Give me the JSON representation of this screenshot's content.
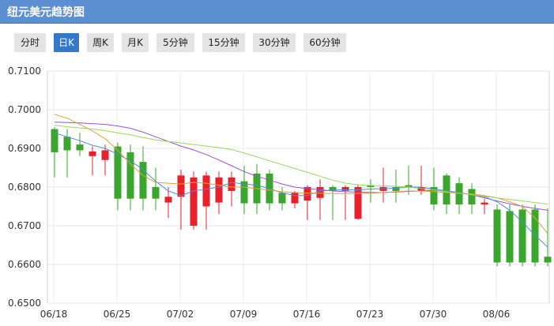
{
  "header": {
    "title": "纽元美元趋势图"
  },
  "tabs": [
    {
      "id": "fenshi",
      "label": "分时",
      "active": false
    },
    {
      "id": "rik",
      "label": "日K",
      "active": true
    },
    {
      "id": "zhouk",
      "label": "周K",
      "active": false
    },
    {
      "id": "yuek",
      "label": "月K",
      "active": false
    },
    {
      "id": "m5",
      "label": "5分钟",
      "active": false
    },
    {
      "id": "m15",
      "label": "15分钟",
      "active": false
    },
    {
      "id": "m30",
      "label": "30分钟",
      "active": false
    },
    {
      "id": "m60",
      "label": "60分钟",
      "active": false
    }
  ],
  "colors": {
    "up": "#e8202a",
    "down": "#3aa62c",
    "ma_purple": "#a050d0",
    "ma_blue": "#4a8fd8",
    "ma_orange": "#e0a040",
    "ma_green": "#98d85a"
  },
  "chart_data": {
    "type": "candlestick",
    "ylim": [
      0.65,
      0.71
    ],
    "yticks": [
      "0.7100",
      "0.7000",
      "0.6900",
      "0.6800",
      "0.6700",
      "0.6600",
      "0.6500"
    ],
    "xticks": [
      "06/18",
      "06/25",
      "07/02",
      "07/09",
      "07/16",
      "07/23",
      "07/30",
      "08/06"
    ],
    "candles": [
      {
        "o": 0.689,
        "c": 0.695,
        "h": 0.6955,
        "l": 0.6825
      },
      {
        "o": 0.6895,
        "c": 0.693,
        "h": 0.695,
        "l": 0.6825
      },
      {
        "o": 0.6895,
        "c": 0.691,
        "h": 0.694,
        "l": 0.688
      },
      {
        "o": 0.688,
        "c": 0.6892,
        "h": 0.6905,
        "l": 0.683
      },
      {
        "o": 0.687,
        "c": 0.6895,
        "h": 0.691,
        "l": 0.683
      },
      {
        "o": 0.677,
        "c": 0.6905,
        "h": 0.6915,
        "l": 0.674
      },
      {
        "o": 0.677,
        "c": 0.689,
        "h": 0.691,
        "l": 0.674
      },
      {
        "o": 0.677,
        "c": 0.6865,
        "h": 0.6905,
        "l": 0.674
      },
      {
        "o": 0.677,
        "c": 0.68,
        "h": 0.685,
        "l": 0.674
      },
      {
        "o": 0.676,
        "c": 0.6775,
        "h": 0.68,
        "l": 0.672
      },
      {
        "o": 0.6775,
        "c": 0.683,
        "h": 0.6845,
        "l": 0.669
      },
      {
        "o": 0.67,
        "c": 0.6825,
        "h": 0.684,
        "l": 0.669
      },
      {
        "o": 0.675,
        "c": 0.683,
        "h": 0.684,
        "l": 0.669
      },
      {
        "o": 0.676,
        "c": 0.6825,
        "h": 0.684,
        "l": 0.673
      },
      {
        "o": 0.679,
        "c": 0.6825,
        "h": 0.684,
        "l": 0.675
      },
      {
        "o": 0.6758,
        "c": 0.6815,
        "h": 0.6855,
        "l": 0.673
      },
      {
        "o": 0.6758,
        "c": 0.6835,
        "h": 0.686,
        "l": 0.673
      },
      {
        "o": 0.6758,
        "c": 0.6835,
        "h": 0.6845,
        "l": 0.674
      },
      {
        "o": 0.6758,
        "c": 0.6785,
        "h": 0.68,
        "l": 0.674
      },
      {
        "o": 0.6758,
        "c": 0.6785,
        "h": 0.679,
        "l": 0.6745
      },
      {
        "o": 0.6765,
        "c": 0.68,
        "h": 0.6805,
        "l": 0.6715
      },
      {
        "o": 0.6772,
        "c": 0.68,
        "h": 0.682,
        "l": 0.6715
      },
      {
        "o": 0.679,
        "c": 0.68,
        "h": 0.6805,
        "l": 0.6715
      },
      {
        "o": 0.679,
        "c": 0.68,
        "h": 0.6805,
        "l": 0.6715
      },
      {
        "o": 0.6718,
        "c": 0.68,
        "h": 0.6805,
        "l": 0.6715
      },
      {
        "o": 0.68,
        "c": 0.6805,
        "h": 0.682,
        "l": 0.676
      },
      {
        "o": 0.679,
        "c": 0.68,
        "h": 0.685,
        "l": 0.676
      },
      {
        "o": 0.679,
        "c": 0.68,
        "h": 0.6845,
        "l": 0.676
      },
      {
        "o": 0.68,
        "c": 0.6805,
        "h": 0.6855,
        "l": 0.678
      },
      {
        "o": 0.679,
        "c": 0.68,
        "h": 0.6855,
        "l": 0.678
      },
      {
        "o": 0.6755,
        "c": 0.68,
        "h": 0.685,
        "l": 0.674
      },
      {
        "o": 0.6755,
        "c": 0.683,
        "h": 0.6835,
        "l": 0.673
      },
      {
        "o": 0.6755,
        "c": 0.681,
        "h": 0.6825,
        "l": 0.673
      },
      {
        "o": 0.6755,
        "c": 0.6795,
        "h": 0.681,
        "l": 0.673
      },
      {
        "o": 0.6755,
        "c": 0.676,
        "h": 0.677,
        "l": 0.673
      },
      {
        "o": 0.6605,
        "c": 0.6742,
        "h": 0.6755,
        "l": 0.6595
      },
      {
        "o": 0.6605,
        "c": 0.6738,
        "h": 0.6755,
        "l": 0.6595
      },
      {
        "o": 0.6605,
        "c": 0.6742,
        "h": 0.6755,
        "l": 0.6595
      },
      {
        "o": 0.6605,
        "c": 0.6742,
        "h": 0.6755,
        "l": 0.6595
      },
      {
        "o": 0.6605,
        "c": 0.662,
        "h": 0.6745,
        "l": 0.6595
      }
    ],
    "moving_averages": [
      {
        "color": "#a050d0",
        "values": [
          0.6968,
          0.6967,
          0.6966,
          0.6964,
          0.6962,
          0.6958,
          0.6952,
          0.6942,
          0.693,
          0.6918,
          0.6906,
          0.6896,
          0.6884,
          0.687,
          0.6855,
          0.684,
          0.6828,
          0.6818,
          0.6808,
          0.68,
          0.6796,
          0.6793,
          0.679,
          0.6788,
          0.6787,
          0.6786,
          0.6786,
          0.6787,
          0.6789,
          0.679,
          0.6791,
          0.679,
          0.6786,
          0.678,
          0.6772,
          0.6764,
          0.6757,
          0.675,
          0.6745,
          0.674
        ]
      },
      {
        "color": "#4a8fd8",
        "values": [
          0.694,
          0.693,
          0.692,
          0.6908,
          0.69,
          0.6885,
          0.6868,
          0.6845,
          0.6815,
          0.679,
          0.6778,
          0.679,
          0.6795,
          0.68,
          0.6812,
          0.6808,
          0.6805,
          0.6796,
          0.6785,
          0.6778,
          0.6778,
          0.679,
          0.6792,
          0.6793,
          0.6793,
          0.6795,
          0.6796,
          0.6797,
          0.68,
          0.68,
          0.6795,
          0.679,
          0.6785,
          0.678,
          0.6775,
          0.6762,
          0.674,
          0.671,
          0.6675,
          0.6645
        ]
      },
      {
        "color": "#e0a040",
        "values": [
          0.6988,
          0.6978,
          0.6962,
          0.6945,
          0.6925,
          0.6895,
          0.686,
          0.683,
          0.6812,
          0.681,
          0.6808,
          0.6812,
          0.681,
          0.6805,
          0.68,
          0.68,
          0.6796,
          0.6792,
          0.6788,
          0.6786,
          0.6784,
          0.6784,
          0.6783,
          0.6783,
          0.6783,
          0.6784,
          0.6786,
          0.6788,
          0.679,
          0.679,
          0.6788,
          0.6786,
          0.6784,
          0.6782,
          0.6778,
          0.6772,
          0.6762,
          0.675,
          0.672,
          0.668
        ]
      },
      {
        "color": "#98d85a",
        "values": [
          0.696,
          0.6956,
          0.6953,
          0.695,
          0.6946,
          0.694,
          0.6935,
          0.6928,
          0.6922,
          0.6918,
          0.6914,
          0.691,
          0.6906,
          0.6902,
          0.6897,
          0.6888,
          0.6878,
          0.6868,
          0.6858,
          0.6848,
          0.6838,
          0.6828,
          0.6818,
          0.681,
          0.6806,
          0.6804,
          0.6803,
          0.6802,
          0.68,
          0.6796,
          0.6792,
          0.6788,
          0.6784,
          0.678,
          0.6776,
          0.6772,
          0.6768,
          0.6764,
          0.676,
          0.6756
        ]
      }
    ]
  }
}
